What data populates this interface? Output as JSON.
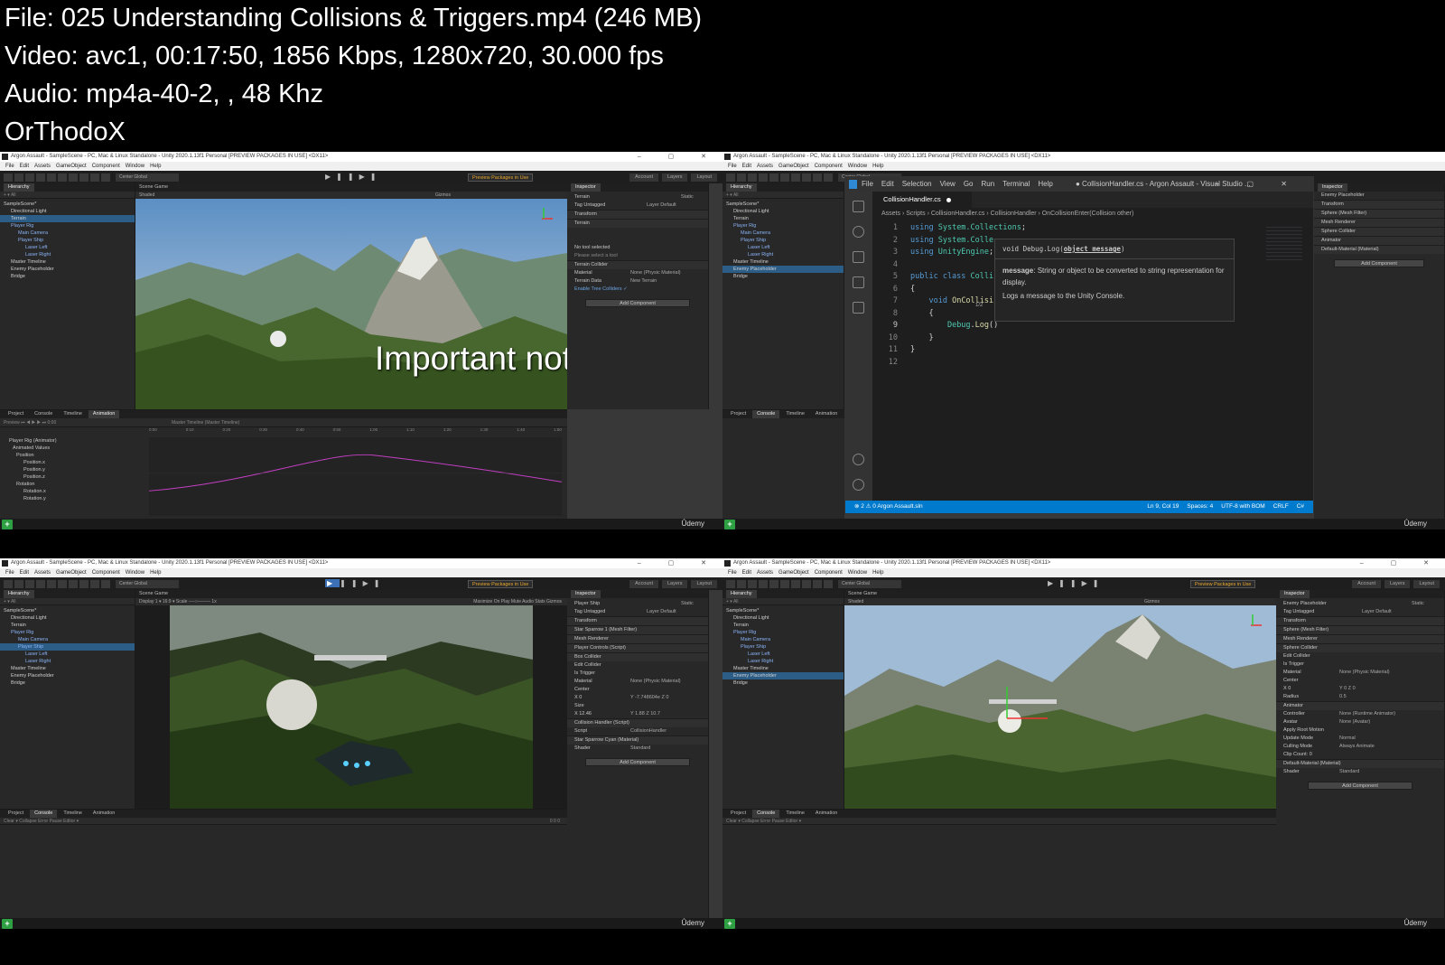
{
  "info": {
    "file_line": "File: 025 Understanding Collisions & Triggers.mp4 (246 MB)",
    "video_line": "Video: avc1, 00:17:50, 1856 Kbps, 1280x720, 30.000 fps",
    "audio_line": "Audio: mp4a-40-2, , 48 Khz",
    "credit": "OrThodoX"
  },
  "unity": {
    "title": "Argon Assault - SampleScene - PC, Mac & Linux Standalone - Unity 2020.1.13f1 Personal [PREVIEW PACKAGES IN USE] <DX11>",
    "menu": [
      "File",
      "Edit",
      "Assets",
      "GameObject",
      "Component",
      "Window",
      "Help"
    ],
    "pivot": "Center  Global",
    "preview_packages": "Preview Packages in Use",
    "account": "Account",
    "layers": "Layers",
    "layout": "Layout",
    "hierarchy_tab": "Hierarchy",
    "scene_tab": "Scene",
    "game_tab": "Game",
    "inspector_tab": "Inspector",
    "shaded": "Shaded",
    "gizmos": "Gizmos",
    "search_all": "All",
    "udemy": "Ûdemy"
  },
  "hierarchy": {
    "items": [
      {
        "label": "SampleScene*",
        "indent": 0
      },
      {
        "label": "Directional Light",
        "indent": 1
      },
      {
        "label": "Terrain",
        "indent": 1
      },
      {
        "label": "Player Rig",
        "indent": 1
      },
      {
        "label": "Main Camera",
        "indent": 2
      },
      {
        "label": "Player Ship",
        "indent": 2
      },
      {
        "label": "Laser Left",
        "indent": 3
      },
      {
        "label": "Laser Right",
        "indent": 3
      },
      {
        "label": "Master Timeline",
        "indent": 1
      },
      {
        "label": "Enemy Placeholder",
        "indent": 1
      },
      {
        "label": "Bridge",
        "indent": 1
      }
    ]
  },
  "frame1": {
    "overlay_note": "Important note!",
    "inspector": {
      "object": "Terrain",
      "static": "Static",
      "tag": "Tag  Untagged",
      "layer": "Layer  Default",
      "transform": "Transform",
      "terrain": "Terrain",
      "no_tool": "No tool selected",
      "please_select": "Please select a tool",
      "terrain_collider": "Terrain Collider",
      "material_label": "Material",
      "material_value": "None (Physic Material)",
      "terrain_data_label": "Terrain Data",
      "terrain_data_value": "New Terrain",
      "enable_tree": "Enable Tree Colliders ✓",
      "add_component": "Add Component"
    },
    "bottom_tabs": [
      "Project",
      "Console",
      "Timeline",
      "Animation"
    ],
    "anim": {
      "preview": "Preview",
      "time": "0:00",
      "master": "Master Timeline (Master Timeline)",
      "clip": "Player Rig (Animator)",
      "props": [
        "Animated Values",
        "Position",
        "Position.x",
        "Position.y",
        "Position.z",
        "Rotation",
        "Rotation.x",
        "Rotation.y"
      ],
      "ticks": [
        "0:00",
        "0:10",
        "0:20",
        "0:30",
        "0:40",
        "0:50",
        "1:00",
        "1:10",
        "1:20",
        "1:30",
        "1:40",
        "1:50"
      ]
    }
  },
  "frame2": {
    "vscode": {
      "menu": [
        "File",
        "Edit",
        "Selection",
        "View",
        "Go",
        "Run",
        "Terminal",
        "Help"
      ],
      "title": "● CollisionHandler.cs - Argon Assault - Visual Studio ...",
      "tab": "CollisionHandler.cs",
      "breadcrumb": "Assets › Scripts › CollisionHandler.cs › CollisionHandler › OnCollisionEnter(Collision other)",
      "lines": [
        {
          "n": "1",
          "tokens": [
            [
              "kw",
              "using "
            ],
            [
              "ty",
              "System.Collections"
            ],
            [
              "pl",
              ";"
            ]
          ]
        },
        {
          "n": "2",
          "tokens": [
            [
              "kw",
              "using "
            ],
            [
              "ty",
              "System.Colle"
            ]
          ]
        },
        {
          "n": "3",
          "tokens": [
            [
              "kw",
              "using "
            ],
            [
              "ty",
              "UnityEngine"
            ],
            [
              "pl",
              ";"
            ]
          ]
        },
        {
          "n": "4",
          "tokens": []
        },
        {
          "n": "5",
          "tokens": [
            [
              "kw",
              "public class "
            ],
            [
              "ty",
              "Colli"
            ]
          ]
        },
        {
          "n": "6",
          "tokens": [
            [
              "pl",
              "{"
            ]
          ]
        },
        {
          "n": "7",
          "tokens": [
            [
              "pl",
              "    "
            ],
            [
              "kw",
              "void "
            ],
            [
              "fn",
              "OnCollisi"
            ]
          ]
        },
        {
          "n": "8",
          "tokens": [
            [
              "pl",
              "    {"
            ]
          ]
        },
        {
          "n": "9",
          "tokens": [
            [
              "pl",
              "        "
            ],
            [
              "ty",
              "Debug"
            ],
            [
              "pl",
              "."
            ],
            [
              "fn",
              "Log"
            ],
            [
              "pl",
              "()"
            ]
          ]
        },
        {
          "n": "10",
          "tokens": [
            [
              "pl",
              "    }"
            ]
          ]
        },
        {
          "n": "11",
          "tokens": [
            [
              "pl",
              "}"
            ]
          ]
        },
        {
          "n": "12",
          "tokens": []
        }
      ],
      "hover_sig_pre": "void Debug.Log(",
      "hover_sig_param": "object message",
      "hover_sig_post": ")",
      "hover_param_name": "message",
      "hover_param_desc": ": String or object to be converted to string representation for display.",
      "hover_summary": "Logs a message to the Unity Console.",
      "hover_page": "1/2",
      "status_left": "⊗ 2 ⚠ 0    Argon Assault.sln",
      "status_right": [
        "Ln 9, Col 19",
        "Spaces: 4",
        "UTF-8 with BOM",
        "CRLF",
        "C#"
      ]
    },
    "inspector": {
      "object": "Enemy Placeholder",
      "items": [
        "Transform",
        "Sphere (Mesh Filter)",
        "Mesh Renderer",
        "Sphere Collider",
        "Animator",
        "Default-Material (Material)"
      ],
      "add_component": "Add Component"
    }
  },
  "frame3": {
    "game_bar": "Display 1  ▾   16:9   ▾   Scale ──○──── 1x",
    "game_opts": "Maximize On Play   Mute Audio   Stats   Gizmos",
    "inspector": {
      "object": "Player Ship",
      "static": "Static",
      "tag": "Tag  Untagged",
      "layer": "Layer  Default",
      "rows": [
        {
          "label": "Transform",
          "comp": true
        },
        {
          "label": "Star Sparrow 1 (Mesh Filter)",
          "comp": true
        },
        {
          "label": "Mesh Renderer",
          "comp": true
        },
        {
          "label": "Player Controls (Script)",
          "comp": true
        },
        {
          "label": "Box Collider",
          "comp": true
        },
        {
          "label": "Edit Collider",
          "comp": false
        },
        {
          "label": "Is Trigger",
          "comp": false
        },
        {
          "label": "Material",
          "comp": false,
          "value": "None (Physic Material)"
        },
        {
          "label": "Center",
          "comp": false
        },
        {
          "label": "X 0",
          "comp": false,
          "value": "Y -7.748604e   Z 0"
        },
        {
          "label": "Size",
          "comp": false
        },
        {
          "label": "X 12.46",
          "comp": false,
          "value": "Y 1.88        Z 10.7"
        },
        {
          "label": "Collision Handler (Script)",
          "comp": true
        },
        {
          "label": "Script",
          "comp": false,
          "value": "CollisionHandler"
        },
        {
          "label": "Star Sparrow Cyan (Material)",
          "comp": true
        },
        {
          "label": "Shader",
          "comp": false,
          "value": "Standard"
        }
      ],
      "add_component": "Add Component"
    },
    "bottom_tabs": [
      "Project",
      "Console",
      "Timeline",
      "Animation"
    ],
    "console_bar": "Clear  ▾   Collapse   Error Pause   Editor ▾",
    "console_counts": "0   0   0"
  },
  "frame4": {
    "inspector": {
      "object": "Enemy Placeholder",
      "static": "Static",
      "tag": "Tag  Untagged",
      "layer": "Layer  Default",
      "rows": [
        {
          "label": "Transform",
          "comp": true
        },
        {
          "label": "Sphere (Mesh Filter)",
          "comp": true
        },
        {
          "label": "Mesh Renderer",
          "comp": true
        },
        {
          "label": "Sphere Collider",
          "comp": true
        },
        {
          "label": "Edit Collider",
          "comp": false
        },
        {
          "label": "Is Trigger",
          "comp": false
        },
        {
          "label": "Material",
          "comp": false,
          "value": "None (Physic Material)"
        },
        {
          "label": "Center",
          "comp": false
        },
        {
          "label": "X 0",
          "comp": false,
          "value": "Y 0        Z 0"
        },
        {
          "label": "Radius",
          "comp": false,
          "value": "0.5"
        },
        {
          "label": "Animator",
          "comp": true
        },
        {
          "label": "Controller",
          "comp": false,
          "value": "None (Runtime Animator)"
        },
        {
          "label": "Avatar",
          "comp": false,
          "value": "None (Avatar)"
        },
        {
          "label": "Apply Root Motion",
          "comp": false
        },
        {
          "label": "Update Mode",
          "comp": false,
          "value": "Normal"
        },
        {
          "label": "Culling Mode",
          "comp": false,
          "value": "Always Animate"
        },
        {
          "label": "Clip Count: 0",
          "comp": false
        },
        {
          "label": "Default-Material (Material)",
          "comp": true
        },
        {
          "label": "Shader",
          "comp": false,
          "value": "Standard"
        }
      ],
      "add_component": "Add Component"
    },
    "bottom_tabs": [
      "Project",
      "Console",
      "Timeline",
      "Animation"
    ],
    "console_bar": "Clear  ▾   Collapse   Error Pause   Editor ▾"
  },
  "colors": {
    "unity_dark": "#282828",
    "selection": "#2c5d87",
    "vscode_status": "#007acc",
    "play_active": "#3b6fb6",
    "green_plus": "#2ea043"
  }
}
